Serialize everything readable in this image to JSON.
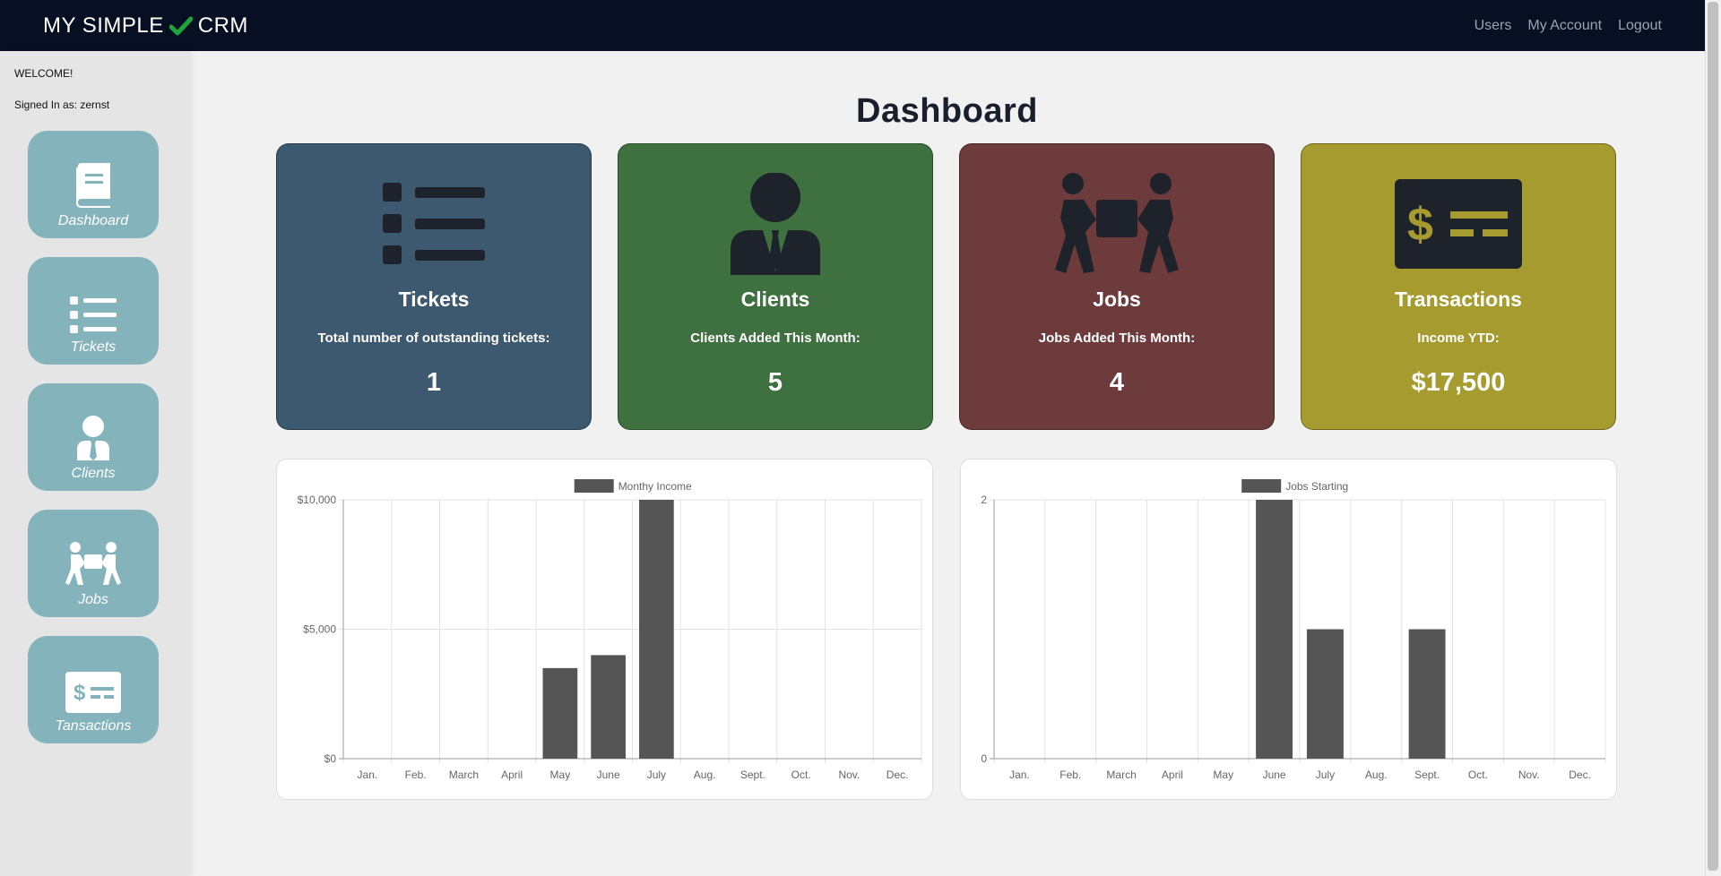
{
  "brand": {
    "left": "MY SIMPLE",
    "right": "CRM"
  },
  "nav": [
    "Users",
    "My Account",
    "Logout"
  ],
  "sidebar": {
    "welcome": "WELCOME!",
    "signed_in": "Signed In as: zernst",
    "items": [
      {
        "label": "Dashboard",
        "icon": "book-icon"
      },
      {
        "label": "Tickets",
        "icon": "list-icon"
      },
      {
        "label": "Clients",
        "icon": "person-icon"
      },
      {
        "label": "Jobs",
        "icon": "movers-icon"
      },
      {
        "label": "Tansactions",
        "icon": "money-check-icon"
      }
    ]
  },
  "page_title": "Dashboard",
  "cards": [
    {
      "title": "Tickets",
      "subtitle": "Total number of outstanding tickets:",
      "value": "1",
      "color": "#3d596f"
    },
    {
      "title": "Clients",
      "subtitle": "Clients Added This Month:",
      "value": "5",
      "color": "#3f7040"
    },
    {
      "title": "Jobs",
      "subtitle": "Jobs Added This Month:",
      "value": "4",
      "color": "#6e3b3d"
    },
    {
      "title": "Transactions",
      "subtitle": "Income YTD:",
      "value": "$17,500",
      "color": "#a69b2f"
    }
  ],
  "colors": {
    "bar": "#555555",
    "icon_dark": "#1e222a",
    "grid": "#e3e3e3"
  },
  "chart_data": [
    {
      "type": "bar",
      "categories": [
        "Jan.",
        "Feb.",
        "March",
        "April",
        "May",
        "June",
        "July",
        "Aug.",
        "Sept.",
        "Oct.",
        "Nov.",
        "Dec."
      ],
      "series": [
        {
          "name": "Monthy Income",
          "values": [
            0,
            0,
            0,
            0,
            3500,
            4000,
            10000,
            0,
            0,
            0,
            0,
            0
          ]
        }
      ],
      "yticks": [
        "$0",
        "$5,000",
        "$10,000"
      ],
      "ylim": [
        0,
        10000
      ],
      "legend": "top-center",
      "grid": true
    },
    {
      "type": "bar",
      "categories": [
        "Jan.",
        "Feb.",
        "March",
        "April",
        "May",
        "June",
        "July",
        "Aug.",
        "Sept.",
        "Oct.",
        "Nov.",
        "Dec."
      ],
      "series": [
        {
          "name": "Jobs Starting",
          "values": [
            0,
            0,
            0,
            0,
            0,
            2,
            1,
            0,
            1,
            0,
            0,
            0
          ]
        }
      ],
      "yticks": [
        "0",
        "2"
      ],
      "ylim": [
        0,
        2
      ],
      "legend": "top-center",
      "grid": true
    }
  ]
}
